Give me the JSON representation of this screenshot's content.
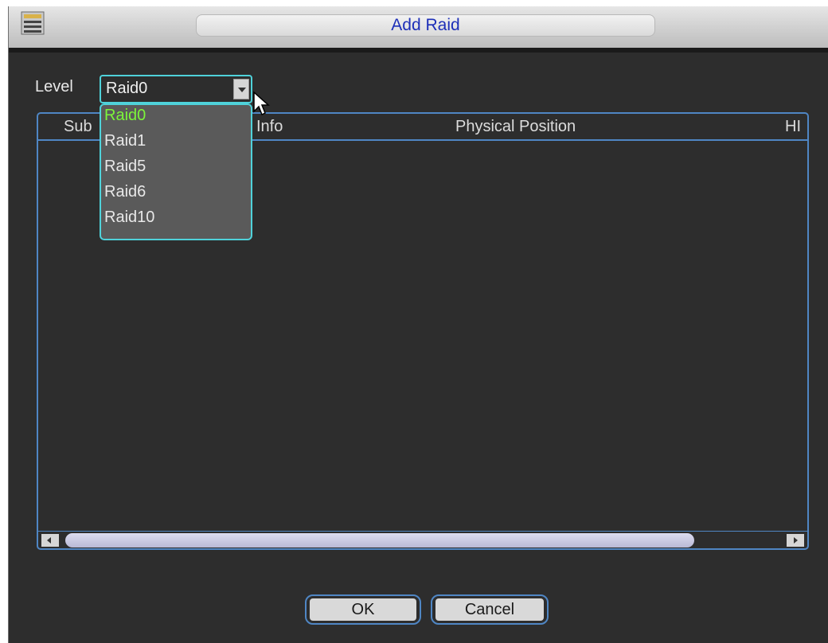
{
  "window": {
    "title": "Add Raid"
  },
  "level": {
    "label": "Level",
    "selected": "Raid0",
    "options": [
      "Raid0",
      "Raid1",
      "Raid5",
      "Raid6",
      "Raid10"
    ]
  },
  "table": {
    "columns": [
      "Sub",
      "Info",
      "Physical Position",
      "HI"
    ]
  },
  "buttons": {
    "ok": "OK",
    "cancel": "Cancel"
  },
  "colors": {
    "accent": "#4fd2da",
    "title_text": "#1d2fb8",
    "selected_option": "#7cf53a"
  }
}
